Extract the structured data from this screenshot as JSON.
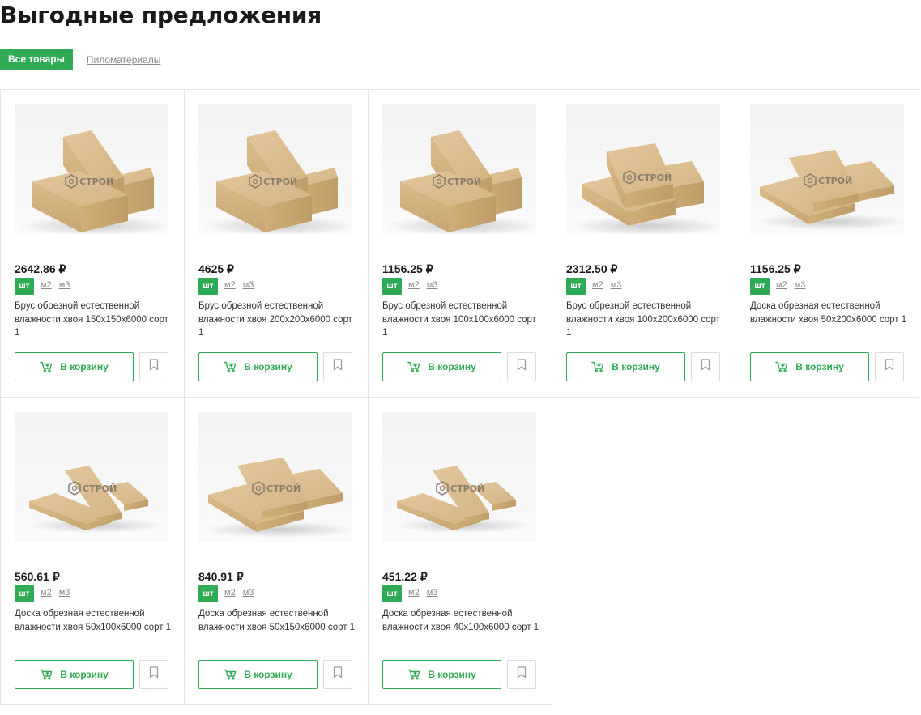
{
  "heading": "Выгодные предложения",
  "filters": [
    {
      "label": "Все товары",
      "active": true
    },
    {
      "label": "Пиломатериалы",
      "active": false
    }
  ],
  "watermark": "СТРОЙ",
  "cart_label": "В корзину",
  "colors": {
    "accent": "#2faa55",
    "border": "#e4e4e4",
    "muted": "#8a8a8a"
  },
  "icons": {
    "cart": "cart-icon",
    "bookmark": "bookmark-icon",
    "logo": "stroy-logo-icon"
  },
  "products": [
    {
      "price": "2642.86 ₽",
      "units": [
        "шт",
        "м2",
        "м3"
      ],
      "title": "Брус обрезной естественной влажности хвоя 150x150x6000 сорт 1",
      "image": "beam-stack"
    },
    {
      "price": "4625 ₽",
      "units": [
        "шт",
        "м2",
        "м3"
      ],
      "title": "Брус обрезной естественной влажности хвоя 200x200x6000 сорт 1",
      "image": "beam-stack"
    },
    {
      "price": "1156.25 ₽",
      "units": [
        "шт",
        "м2",
        "м3"
      ],
      "title": "Брус обрезной естественной влажности хвоя 100x100x6000 сорт 1",
      "image": "beam-stack"
    },
    {
      "price": "2312.50 ₽",
      "units": [
        "шт",
        "м2",
        "м3"
      ],
      "title": "Брус обрезной естественной влажности хвоя 100x200x6000 сорт 1",
      "image": "flat-beam-stack"
    },
    {
      "price": "1156.25 ₽",
      "units": [
        "шт",
        "м2",
        "м3"
      ],
      "title": "Доска обрезная естественной влажности хвоя 50x200x6000 сорт 1",
      "image": "plank-stack"
    },
    {
      "price": "560.61 ₽",
      "units": [
        "шт",
        "м2",
        "м3"
      ],
      "title": "Доска обрезная естественной влажности хвоя 50x100x6000 сорт 1",
      "image": "thin-plank-stack"
    },
    {
      "price": "840.91 ₽",
      "units": [
        "шт",
        "м2",
        "м3"
      ],
      "title": "Доска обрезная естественной влажности хвоя 50x150x6000 сорт 1",
      "image": "plank-stack"
    },
    {
      "price": "451.22 ₽",
      "units": [
        "шт",
        "м2",
        "м3"
      ],
      "title": "Доска обрезная естественной влажности хвоя 40x100x6000 сорт 1",
      "image": "thin-plank-stack"
    }
  ]
}
